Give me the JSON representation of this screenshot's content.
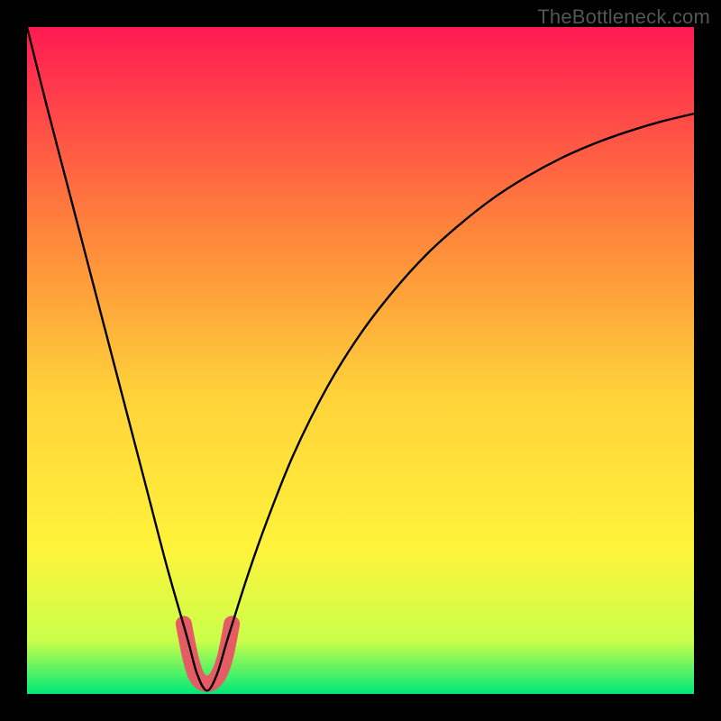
{
  "watermark": "TheBottleneck.com",
  "chart_data": {
    "type": "line",
    "title": "",
    "xlabel": "",
    "ylabel": "",
    "xlim": [
      0,
      100
    ],
    "ylim": [
      0,
      100
    ],
    "series": [
      {
        "name": "curve",
        "x": [
          0,
          3,
          6,
          9,
          12,
          15,
          18,
          21,
          24,
          25.5,
          27,
          28.5,
          30,
          33,
          36,
          40,
          45,
          50,
          55,
          60,
          65,
          70,
          75,
          80,
          85,
          90,
          95,
          100
        ],
        "y": [
          100,
          88,
          76.5,
          65,
          53.5,
          42,
          30.5,
          19,
          8.5,
          3,
          0.5,
          3,
          8,
          17.5,
          26,
          36,
          46,
          54,
          60.5,
          66,
          70.5,
          74.4,
          77.6,
          80.3,
          82.5,
          84.3,
          85.8,
          87
        ]
      },
      {
        "name": "highlight",
        "x": [
          23.5,
          24.5,
          25.5,
          27,
          28.5,
          29.7,
          30.7
        ],
        "y": [
          10.5,
          5.5,
          2.5,
          1.5,
          2.5,
          5.5,
          10.5
        ]
      }
    ],
    "background_gradient": {
      "top": "#ff1a52",
      "mid_upper": "#ff833b",
      "mid": "#ffd23a",
      "mid_lower": "#fff33a",
      "band": "#caff4a",
      "bottom": "#00e878"
    },
    "highlight_color": "#e65c64",
    "curve_color": "#000000"
  }
}
